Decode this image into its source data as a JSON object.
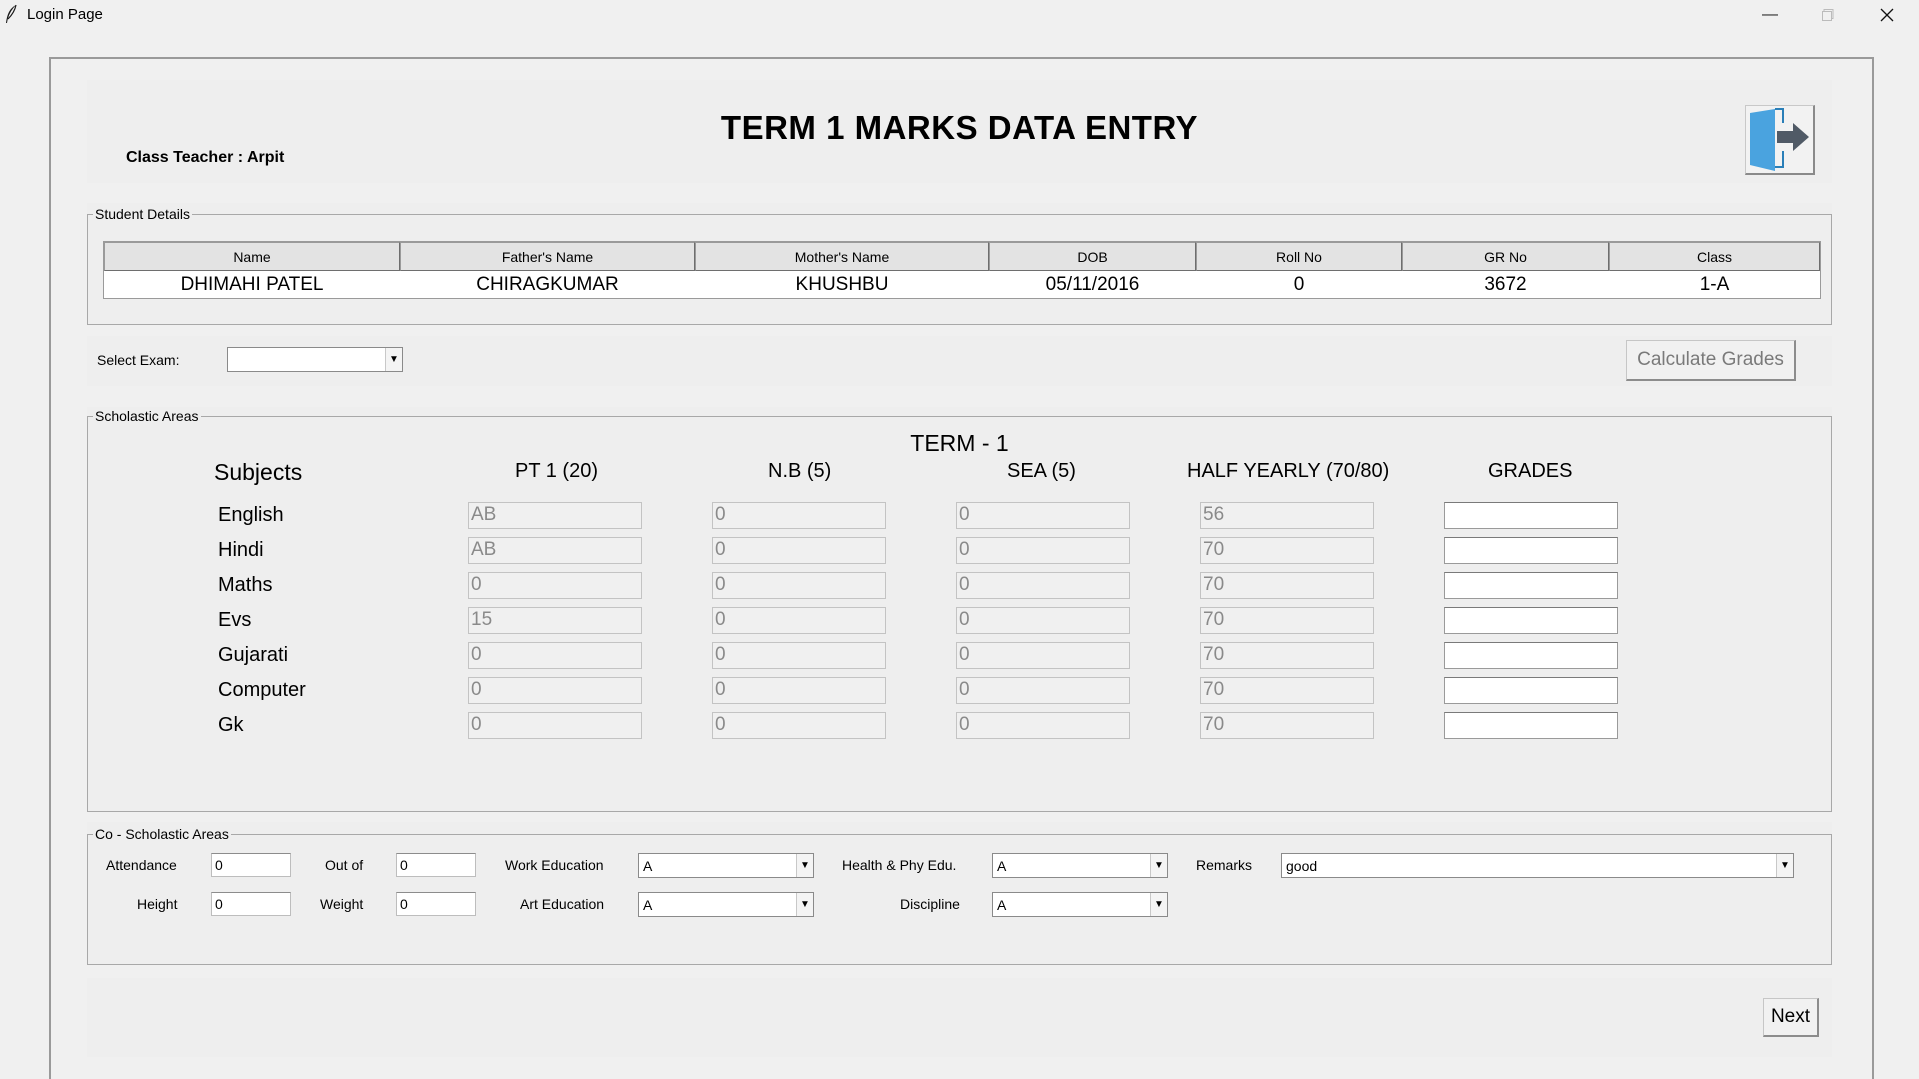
{
  "window": {
    "title": "Login Page"
  },
  "header": {
    "title": "TERM 1 MARKS DATA ENTRY",
    "teacher": "Class Teacher : Arpit"
  },
  "student_details": {
    "label": "Student Details",
    "columns": [
      "Name",
      "Father's Name",
      "Mother's Name",
      "DOB",
      "Roll No",
      "GR No",
      "Class"
    ],
    "values": [
      "DHIMAHI PATEL",
      "CHIRAGKUMAR",
      "KHUSHBU",
      "05/11/2016",
      "0",
      "3672",
      "1-A"
    ]
  },
  "exam": {
    "label": "Select Exam:",
    "selected": "",
    "calculate_label": "Calculate Grades"
  },
  "scholastic": {
    "label": "Scholastic Areas",
    "term_title": "TERM - 1",
    "subjects_header": "Subjects",
    "columns": [
      "PT 1 (20)",
      "N.B (5)",
      "SEA (5)",
      "HALF YEARLY (70/80)",
      "GRADES"
    ],
    "rows": [
      {
        "subject": "English",
        "pt1": "AB",
        "nb": "0",
        "sea": "0",
        "half": "56",
        "grade": ""
      },
      {
        "subject": "Hindi",
        "pt1": "AB",
        "nb": "0",
        "sea": "0",
        "half": "70",
        "grade": ""
      },
      {
        "subject": "Maths",
        "pt1": "0",
        "nb": "0",
        "sea": "0",
        "half": "70",
        "grade": ""
      },
      {
        "subject": "Evs",
        "pt1": "15",
        "nb": "0",
        "sea": "0",
        "half": "70",
        "grade": ""
      },
      {
        "subject": "Gujarati",
        "pt1": "0",
        "nb": "0",
        "sea": "0",
        "half": "70",
        "grade": ""
      },
      {
        "subject": "Computer",
        "pt1": "0",
        "nb": "0",
        "sea": "0",
        "half": "70",
        "grade": ""
      },
      {
        "subject": "Gk",
        "pt1": "0",
        "nb": "0",
        "sea": "0",
        "half": "70",
        "grade": ""
      }
    ]
  },
  "co_scholastic": {
    "label": "Co - Scholastic Areas",
    "attendance_label": "Attendance",
    "attendance": "0",
    "out_of_label": "Out of",
    "out_of": "0",
    "height_label": "Height",
    "height": "0",
    "weight_label": "Weight",
    "weight": "0",
    "work_education_label": "Work Education",
    "work_education": "A",
    "art_education_label": "Art Education",
    "art_education": "A",
    "health_label": "Health & Phy Edu.",
    "health": "A",
    "discipline_label": "Discipline",
    "discipline": "A",
    "remarks_label": "Remarks",
    "remarks": "good"
  },
  "footer": {
    "next_label": "Next"
  },
  "icons": {
    "app": "feather-icon",
    "minimize": "minimize-icon",
    "maximize": "maximize-icon",
    "close": "close-icon",
    "exit": "logout-door-icon",
    "dropdown": "chevron-down-icon"
  },
  "colors": {
    "exit_icon": "#4aa3df",
    "background": "#f0f0f0"
  }
}
